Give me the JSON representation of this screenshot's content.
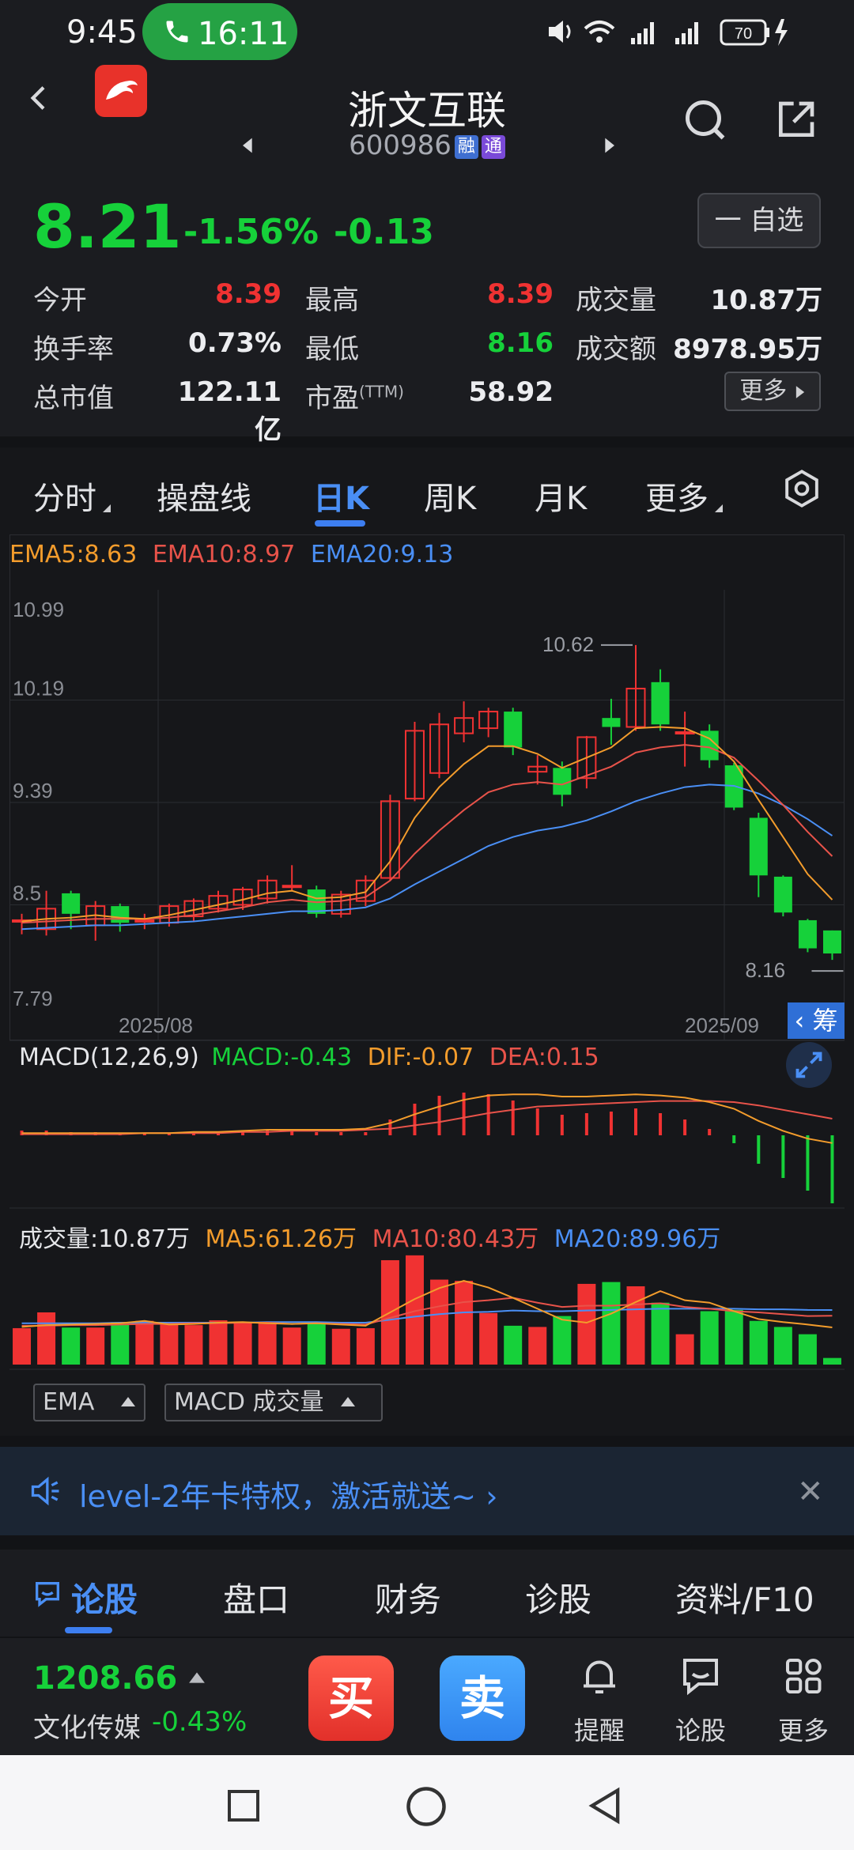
{
  "status_bar": {
    "time": "9:45",
    "call_time": "16:11",
    "battery": "70"
  },
  "header": {
    "stock_name": "浙文互联",
    "stock_code": "600986",
    "tag_margin": "融",
    "tag_connect": "通"
  },
  "quote": {
    "price": "8.21",
    "change_pct": "-1.56%",
    "change_abs": "-0.13",
    "watch_button": "一 自选",
    "more_button": "更多",
    "stats": {
      "open_label": "今开",
      "open_value": "8.39",
      "high_label": "最高",
      "high_value": "8.39",
      "volume_label": "成交量",
      "volume_value": "10.87万",
      "turnover_label": "换手率",
      "turnover_value": "0.73%",
      "low_label": "最低",
      "low_value": "8.16",
      "amount_label": "成交额",
      "amount_value": "8978.95万",
      "mcap_label": "总市值",
      "mcap_value": "122.11亿",
      "pe_label": "市盈",
      "pe_sup": "(TTM)",
      "pe_value": "58.92"
    }
  },
  "chart_tabs": [
    {
      "label": "分时",
      "active": false
    },
    {
      "label": "操盘线",
      "active": false
    },
    {
      "label": "日K",
      "active": true
    },
    {
      "label": "周K",
      "active": false
    },
    {
      "label": "月K",
      "active": false
    },
    {
      "label": "更多",
      "active": false
    }
  ],
  "ema_legend": {
    "ema5": "EMA5:8.63",
    "ema10": "EMA10:8.97",
    "ema20": "EMA20:9.13"
  },
  "chip_button": "筹",
  "macd_legend": {
    "title": "MACD(12,26,9)",
    "macd": "MACD:-0.43",
    "dif": "DIF:-0.07",
    "dea": "DEA:0.15"
  },
  "volume_legend": {
    "title": "成交量:10.87万",
    "ma5": "MA5:61.26万",
    "ma10": "MA10:80.43万",
    "ma20": "MA20:89.96万"
  },
  "indicator_buttons": {
    "main": "EMA",
    "sub": "MACD 成交量"
  },
  "colors": {
    "up": "#f03232",
    "down": "#16d13a",
    "ema5": "#f39c2c",
    "ema10": "#e8534a",
    "ema20": "#4a8ff5",
    "accent": "#3d7ef0"
  },
  "chart_data": {
    "type": "candlestick",
    "y_ticks": [
      "10.99",
      "10.19",
      "9.39",
      "8.5",
      "7.79"
    ],
    "x_ticks": [
      "2025/08",
      "2025/09"
    ],
    "ylim": [
      7.79,
      10.99
    ],
    "max_annotation": "10.62",
    "min_annotation": "8.16",
    "candles": [
      {
        "o": 8.47,
        "c": 8.47,
        "h": 8.52,
        "l": 8.36
      },
      {
        "o": 8.4,
        "c": 8.56,
        "h": 8.7,
        "l": 8.35
      },
      {
        "o": 8.68,
        "c": 8.52,
        "h": 8.7,
        "l": 8.4
      },
      {
        "o": 8.43,
        "c": 8.58,
        "h": 8.62,
        "l": 8.31
      },
      {
        "o": 8.58,
        "c": 8.45,
        "h": 8.6,
        "l": 8.38
      },
      {
        "o": 8.47,
        "c": 8.47,
        "h": 8.52,
        "l": 8.4
      },
      {
        "o": 8.45,
        "c": 8.58,
        "h": 8.6,
        "l": 8.42
      },
      {
        "o": 8.5,
        "c": 8.62,
        "h": 8.64,
        "l": 8.46
      },
      {
        "o": 8.56,
        "c": 8.66,
        "h": 8.7,
        "l": 8.53
      },
      {
        "o": 8.59,
        "c": 8.71,
        "h": 8.73,
        "l": 8.55
      },
      {
        "o": 8.64,
        "c": 8.78,
        "h": 8.82,
        "l": 8.6
      },
      {
        "o": 8.74,
        "c": 8.74,
        "h": 8.9,
        "l": 8.7
      },
      {
        "o": 8.71,
        "c": 8.52,
        "h": 8.74,
        "l": 8.49
      },
      {
        "o": 8.52,
        "c": 8.67,
        "h": 8.7,
        "l": 8.49
      },
      {
        "o": 8.62,
        "c": 8.78,
        "h": 8.82,
        "l": 8.58
      },
      {
        "o": 8.8,
        "c": 9.4,
        "h": 9.45,
        "l": 8.78
      },
      {
        "o": 9.42,
        "c": 9.95,
        "h": 10.02,
        "l": 9.4
      },
      {
        "o": 9.62,
        "c": 10.0,
        "h": 10.09,
        "l": 9.58
      },
      {
        "o": 9.93,
        "c": 10.05,
        "h": 10.18,
        "l": 9.86
      },
      {
        "o": 9.97,
        "c": 10.1,
        "h": 10.13,
        "l": 9.9
      },
      {
        "o": 10.1,
        "c": 9.82,
        "h": 10.13,
        "l": 9.76
      },
      {
        "o": 9.63,
        "c": 9.67,
        "h": 9.76,
        "l": 9.53
      },
      {
        "o": 9.66,
        "c": 9.45,
        "h": 9.71,
        "l": 9.36
      },
      {
        "o": 9.58,
        "c": 9.9,
        "h": 9.91,
        "l": 9.5
      },
      {
        "o": 10.05,
        "c": 9.98,
        "h": 10.2,
        "l": 9.84
      },
      {
        "o": 9.98,
        "c": 10.28,
        "h": 10.62,
        "l": 9.95
      },
      {
        "o": 10.33,
        "c": 10.0,
        "h": 10.43,
        "l": 9.95
      },
      {
        "o": 9.93,
        "c": 9.94,
        "h": 10.1,
        "l": 9.67
      },
      {
        "o": 9.95,
        "c": 9.72,
        "h": 10.0,
        "l": 9.66
      },
      {
        "o": 9.68,
        "c": 9.35,
        "h": 9.7,
        "l": 9.33
      },
      {
        "o": 9.27,
        "c": 8.82,
        "h": 9.31,
        "l": 8.65
      },
      {
        "o": 8.81,
        "c": 8.53,
        "h": 8.82,
        "l": 8.5
      },
      {
        "o": 8.47,
        "c": 8.25,
        "h": 8.48,
        "l": 8.22
      },
      {
        "o": 8.39,
        "c": 8.21,
        "h": 8.39,
        "l": 8.16
      }
    ],
    "ema5": [
      8.46,
      8.48,
      8.49,
      8.51,
      8.49,
      8.48,
      8.51,
      8.55,
      8.59,
      8.63,
      8.68,
      8.7,
      8.64,
      8.65,
      8.69,
      8.93,
      9.27,
      9.51,
      9.69,
      9.83,
      9.83,
      9.77,
      9.66,
      9.74,
      9.82,
      9.97,
      9.98,
      9.97,
      9.89,
      9.71,
      9.41,
      9.12,
      8.83,
      8.63
    ],
    "ema10": [
      8.45,
      8.46,
      8.47,
      8.48,
      8.48,
      8.48,
      8.49,
      8.51,
      8.54,
      8.57,
      8.61,
      8.63,
      8.61,
      8.62,
      8.65,
      8.78,
      8.99,
      9.17,
      9.33,
      9.47,
      9.53,
      9.55,
      9.53,
      9.6,
      9.67,
      9.78,
      9.82,
      9.84,
      9.82,
      9.74,
      9.56,
      9.37,
      9.16,
      8.97
    ],
    "ema20": [
      8.4,
      8.41,
      8.42,
      8.43,
      8.43,
      8.44,
      8.45,
      8.46,
      8.48,
      8.5,
      8.52,
      8.54,
      8.54,
      8.55,
      8.57,
      8.64,
      8.75,
      8.85,
      8.95,
      9.05,
      9.12,
      9.17,
      9.2,
      9.25,
      9.32,
      9.4,
      9.46,
      9.51,
      9.53,
      9.52,
      9.46,
      9.37,
      9.26,
      9.13
    ],
    "macd": [
      0.03,
      0.03,
      0.02,
      0.02,
      0.01,
      0.01,
      0.01,
      0.02,
      0.02,
      0.02,
      0.03,
      0.03,
      0.02,
      0.02,
      0.02,
      0.1,
      0.2,
      0.25,
      0.27,
      0.26,
      0.22,
      0.17,
      0.13,
      0.14,
      0.15,
      0.17,
      0.14,
      0.1,
      0.04,
      -0.05,
      -0.18,
      -0.27,
      -0.35,
      -0.43
    ],
    "dif": [
      0.02,
      0.02,
      0.02,
      0.02,
      0.02,
      0.02,
      0.02,
      0.03,
      0.03,
      0.04,
      0.05,
      0.05,
      0.05,
      0.05,
      0.06,
      0.11,
      0.19,
      0.26,
      0.32,
      0.36,
      0.37,
      0.37,
      0.35,
      0.35,
      0.36,
      0.37,
      0.36,
      0.34,
      0.3,
      0.24,
      0.13,
      0.04,
      -0.03,
      -0.07
    ],
    "dea": [
      0.01,
      0.01,
      0.01,
      0.01,
      0.01,
      0.02,
      0.02,
      0.02,
      0.02,
      0.03,
      0.03,
      0.04,
      0.04,
      0.04,
      0.05,
      0.06,
      0.09,
      0.12,
      0.16,
      0.2,
      0.23,
      0.26,
      0.27,
      0.28,
      0.29,
      0.3,
      0.31,
      0.31,
      0.31,
      0.3,
      0.27,
      0.23,
      0.19,
      0.15
    ],
    "volume": [
      60,
      86,
      61,
      61,
      70,
      72,
      69,
      65,
      73,
      68,
      68,
      61,
      70,
      59,
      60,
      172,
      180,
      140,
      138,
      85,
      64,
      62,
      80,
      133,
      136,
      129,
      102,
      50,
      88,
      90,
      72,
      62,
      50,
      10.87
    ],
    "vol_ma5": [
      62,
      65,
      66,
      67,
      68,
      72,
      66,
      67,
      69,
      70,
      68,
      67,
      68,
      66,
      64,
      86,
      108,
      126,
      138,
      127,
      110,
      92,
      74,
      69,
      84,
      103,
      121,
      106,
      102,
      88,
      75,
      70,
      66,
      61.26
    ],
    "vol_ma10": [
      64,
      64,
      65,
      65,
      66,
      67,
      67,
      68,
      68,
      69,
      69,
      67,
      68,
      67,
      66,
      77,
      88,
      96,
      103,
      106,
      110,
      102,
      95,
      97,
      97,
      99,
      101,
      95,
      92,
      88,
      86,
      83,
      80,
      80.43
    ],
    "vol_ma20": [
      68,
      68,
      68,
      68,
      69,
      69,
      69,
      69,
      69,
      69,
      70,
      70,
      70,
      69,
      69,
      74,
      79,
      83,
      86,
      87,
      89,
      88,
      88,
      89,
      90,
      91,
      92,
      92,
      92,
      92,
      91,
      91,
      90,
      89.96
    ],
    "vol_ylim": [
      0,
      185
    ],
    "macd_ylim": [
      -0.5,
      0.5
    ]
  },
  "banner": {
    "text": "level-2年卡特权，激活就送~",
    "chevron": "›",
    "close": "✕"
  },
  "bottom_tabs": [
    {
      "label": "论股",
      "active": true
    },
    {
      "label": "盘口",
      "active": false
    },
    {
      "label": "财务",
      "active": false
    },
    {
      "label": "诊股",
      "active": false
    },
    {
      "label": "资料/F10",
      "active": false
    }
  ],
  "trade_bar": {
    "index_value": "1208.66",
    "index_name": "文化传媒",
    "index_pct": "-0.43%",
    "buy": "买",
    "sell": "卖",
    "remind": "提醒",
    "discuss": "论股",
    "more": "更多"
  }
}
